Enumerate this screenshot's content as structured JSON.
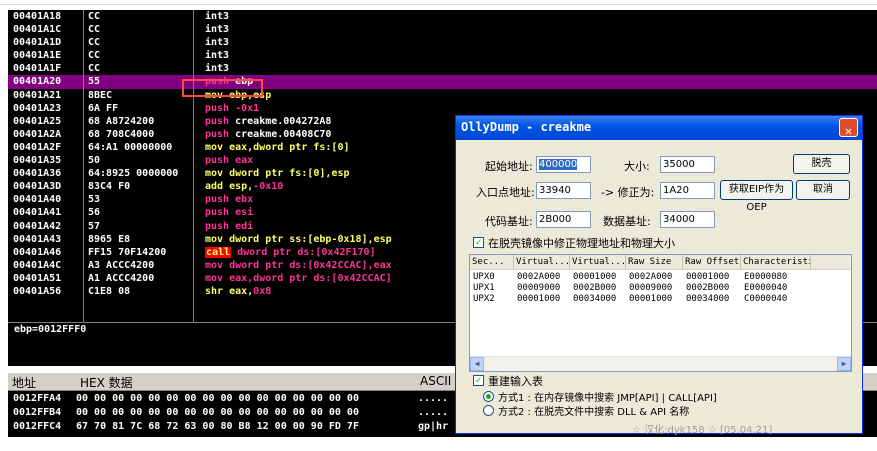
{
  "disasm": {
    "rows": [
      {
        "addr": "00401A18",
        "hex": "CC",
        "tokens": [
          {
            "t": "int3",
            "c": "w"
          }
        ]
      },
      {
        "addr": "00401A1C",
        "hex": "CC",
        "tokens": [
          {
            "t": "int3",
            "c": "w"
          }
        ]
      },
      {
        "addr": "00401A1D",
        "hex": "CC",
        "tokens": [
          {
            "t": "int3",
            "c": "w"
          }
        ]
      },
      {
        "addr": "00401A1E",
        "hex": "CC",
        "tokens": [
          {
            "t": "int3",
            "c": "w"
          }
        ]
      },
      {
        "addr": "00401A1F",
        "hex": "CC",
        "tokens": [
          {
            "t": "int3",
            "c": "w"
          }
        ]
      },
      {
        "addr": "00401A20",
        "hex": "55",
        "selected": true,
        "tokens": [
          {
            "t": "push ",
            "c": "p"
          },
          {
            "t": "ebp",
            "c": "w"
          }
        ]
      },
      {
        "addr": "00401A21",
        "hex": "8BEC",
        "tokens": [
          {
            "t": "mov ebp,esp",
            "c": "m"
          }
        ]
      },
      {
        "addr": "00401A23",
        "hex": "6A FF",
        "tokens": [
          {
            "t": "push ",
            "c": "p"
          },
          {
            "t": "-0x1",
            "c": "i"
          }
        ]
      },
      {
        "addr": "00401A25",
        "hex": "68 A8724200",
        "tokens": [
          {
            "t": "push ",
            "c": "p"
          },
          {
            "t": "creakme.004272A8",
            "c": "w"
          }
        ]
      },
      {
        "addr": "00401A2A",
        "hex": "68 708C4000",
        "tokens": [
          {
            "t": "push ",
            "c": "p"
          },
          {
            "t": "creakme.00408C70",
            "c": "w"
          }
        ]
      },
      {
        "addr": "00401A2F",
        "hex": "64:A1 00000000",
        "tokens": [
          {
            "t": "mov eax,dword ptr fs:[0]",
            "c": "m"
          }
        ]
      },
      {
        "addr": "00401A35",
        "hex": "50",
        "tokens": [
          {
            "t": "push eax",
            "c": "p"
          }
        ]
      },
      {
        "addr": "00401A36",
        "hex": "64:8925 0000000",
        "tokens": [
          {
            "t": "mov dword ptr fs:[0],esp",
            "c": "m"
          }
        ]
      },
      {
        "addr": "00401A3D",
        "hex": "83C4 F0",
        "tokens": [
          {
            "t": "add esp,",
            "c": "m"
          },
          {
            "t": "-0x10",
            "c": "i"
          }
        ]
      },
      {
        "addr": "00401A40",
        "hex": "53",
        "tokens": [
          {
            "t": "push ebx",
            "c": "p"
          }
        ]
      },
      {
        "addr": "00401A41",
        "hex": "56",
        "tokens": [
          {
            "t": "push esi",
            "c": "p"
          }
        ]
      },
      {
        "addr": "00401A42",
        "hex": "57",
        "tokens": [
          {
            "t": "push edi",
            "c": "p"
          }
        ]
      },
      {
        "addr": "00401A43",
        "hex": "8965 E8",
        "tokens": [
          {
            "t": "mov dword ptr ss:[ebp-0x18],esp",
            "c": "m"
          }
        ]
      },
      {
        "addr": "00401A46",
        "hex": "FF15 70F14200",
        "tokens": [
          {
            "t": "call",
            "c": "call"
          },
          {
            "t": " dword ptr ds:[0x42F170]",
            "c": "p"
          }
        ]
      },
      {
        "addr": "00401A4C",
        "hex": "A3 ACCC4200",
        "tokens": [
          {
            "t": "mov dword ptr ds:[0x42CCAC],eax",
            "c": "p"
          }
        ]
      },
      {
        "addr": "00401A51",
        "hex": "A1 ACCC4200",
        "tokens": [
          {
            "t": "mov eax,dword ptr ds:[0x42CCAC]",
            "c": "p"
          }
        ]
      },
      {
        "addr": "00401A56",
        "hex": "C1E8 08",
        "tokens": [
          {
            "t": "shr eax,",
            "c": "m"
          },
          {
            "t": "0x8",
            "c": "i"
          }
        ]
      }
    ],
    "info": "ebp=0012FFF0"
  },
  "dump": {
    "header_addr": "地址",
    "header_hex": "HEX 数据",
    "header_ascii": "ASCII",
    "rows": [
      {
        "addr": "0012FFA4",
        "hex": "00 00 00 00 00 00 00 00 00 00 00 00 00 00 00 00",
        "ascii": "....."
      },
      {
        "addr": "0012FFB4",
        "hex": "00 00 00 00 00 00 00 00 00 00 00 00 00 00 00 00",
        "ascii": "....."
      },
      {
        "addr": "0012FFC4",
        "hex": "67 70 81 7C 68 72 63 00 80 B8 12 00 00 90 FD 7F",
        "ascii": "gp|hr"
      }
    ]
  },
  "dialog": {
    "title": "OllyDump - creakme",
    "start_label": "起始地址:",
    "start_value": "400000",
    "size_label": "大小:",
    "size_value": "35000",
    "dump_button": "脱壳",
    "entry_label": "入口点地址:",
    "entry_value": "33940",
    "fix_label": "-> 修正为:",
    "fix_value": "1A20",
    "get_eip_button": "获取EIP作为OEP",
    "cancel_button": "取消",
    "code_base_label": "代码基址:",
    "code_base_value": "2B000",
    "data_base_label": "数据基址:",
    "data_base_value": "34000",
    "fix_checkbox_label": "在脱壳镜像中修正物理地址和物理大小",
    "table": {
      "headers": [
        "Sec...",
        "Virtual...",
        "Virtual...",
        "Raw Size",
        "Raw Offset",
        "Characteristi"
      ],
      "rows": [
        [
          "UPX0",
          "0002A000",
          "00001000",
          "0002A000",
          "00001000",
          "E0000080"
        ],
        [
          "UPX1",
          "00009000",
          "0002B000",
          "00009000",
          "0002B000",
          "E0000040"
        ],
        [
          "UPX2",
          "00001000",
          "00034000",
          "00001000",
          "00034000",
          "C0000040"
        ]
      ]
    },
    "rebuild_label": "重建输入表",
    "method1_label": "方式1 : 在内存镜像中搜索 JMP[API] | CALL[API]",
    "method2_label": "方式2 : 在脱壳文件中搜索 DLL & API 名称",
    "credit": "☆ 汉化:dyk158 ☆ [05.04.21]"
  }
}
